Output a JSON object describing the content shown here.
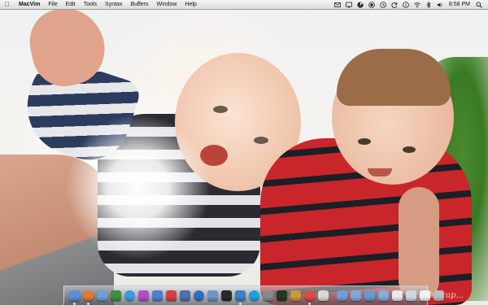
{
  "menubar": {
    "apple_icon": "apple-logo-icon",
    "app_name": "MacVim",
    "menus": [
      "File",
      "Edit",
      "Tools",
      "Syntax",
      "Buffers",
      "Window",
      "Help"
    ],
    "status_icons": [
      {
        "name": "mail-icon",
        "glyph": "✉"
      },
      {
        "name": "screen-icon",
        "glyph": "▭"
      },
      {
        "name": "radioactive-icon",
        "glyph": "☢"
      },
      {
        "name": "record-icon",
        "glyph": "◉"
      },
      {
        "name": "clock-icon",
        "glyph": "◷"
      },
      {
        "name": "sync-icon",
        "glyph": "↻"
      },
      {
        "name": "info-icon",
        "glyph": "ⓘ"
      },
      {
        "name": "wifi-icon",
        "glyph": "wifi"
      },
      {
        "name": "bluetooth-icon",
        "glyph": "ᛒ"
      },
      {
        "name": "volume-icon",
        "glyph": "🔈"
      }
    ],
    "clock": "8:58 PM",
    "search_icon": "spotlight-search-icon"
  },
  "wallpaper": {
    "watermark": "Photograp..."
  },
  "dock": {
    "apps": [
      {
        "name": "finder-icon",
        "color": "#5b8fd8",
        "running": true
      },
      {
        "name": "firefox-icon",
        "color": "#e8772e",
        "running": true,
        "round": true
      },
      {
        "name": "preview-icon",
        "color": "#6aa0d8",
        "running": false
      },
      {
        "name": "pen-icon",
        "color": "#3f8d3f",
        "running": false
      },
      {
        "name": "safari-icon",
        "color": "#3b9be0",
        "running": false,
        "round": true
      },
      {
        "name": "itunes-icon",
        "color": "#b04fc4",
        "running": false
      },
      {
        "name": "app-store-icon",
        "color": "#4a7fd1",
        "running": false
      },
      {
        "name": "calendar-icon",
        "color": "#d64040",
        "running": false
      },
      {
        "name": "xcode-icon",
        "color": "#4b6fb0",
        "running": false
      },
      {
        "name": "network-icon",
        "color": "#2f6fc0",
        "running": false,
        "round": true
      },
      {
        "name": "mail-app-icon",
        "color": "#6c95c8",
        "running": false
      },
      {
        "name": "photo-app-icon",
        "color": "#2a2a2a",
        "running": false
      },
      {
        "name": "vim-icon",
        "color": "#3d7fbf",
        "running": true
      },
      {
        "name": "skype-icon",
        "color": "#1fa0e0",
        "running": false,
        "round": true
      },
      {
        "name": "system-prefs-icon",
        "color": "#8a8a8a",
        "running": false
      },
      {
        "name": "terminal-icon",
        "color": "#1f3a1f",
        "running": false
      },
      {
        "name": "brush-icon",
        "color": "#c89a3a",
        "running": false
      },
      {
        "name": "chrome-icon",
        "color": "#e24a3b",
        "running": true,
        "round": true
      },
      {
        "name": "notes-icon",
        "color": "#d8d8d8",
        "running": false
      }
    ],
    "stacks": [
      {
        "name": "applications-folder-icon",
        "color": "#6f9fd6"
      },
      {
        "name": "documents-folder-icon",
        "color": "#7fa8d8"
      },
      {
        "name": "downloads-folder-icon",
        "color": "#6a9ad0"
      },
      {
        "name": "pictures-folder-icon",
        "color": "#82aedb"
      },
      {
        "name": "document-stack-icon",
        "color": "#eaeaea"
      },
      {
        "name": "window-stack-icon",
        "color": "#cfd8e3"
      },
      {
        "name": "file-stack-icon",
        "color": "#f2f2f2"
      },
      {
        "name": "trash-icon",
        "color": "#b9bcc0"
      }
    ]
  }
}
